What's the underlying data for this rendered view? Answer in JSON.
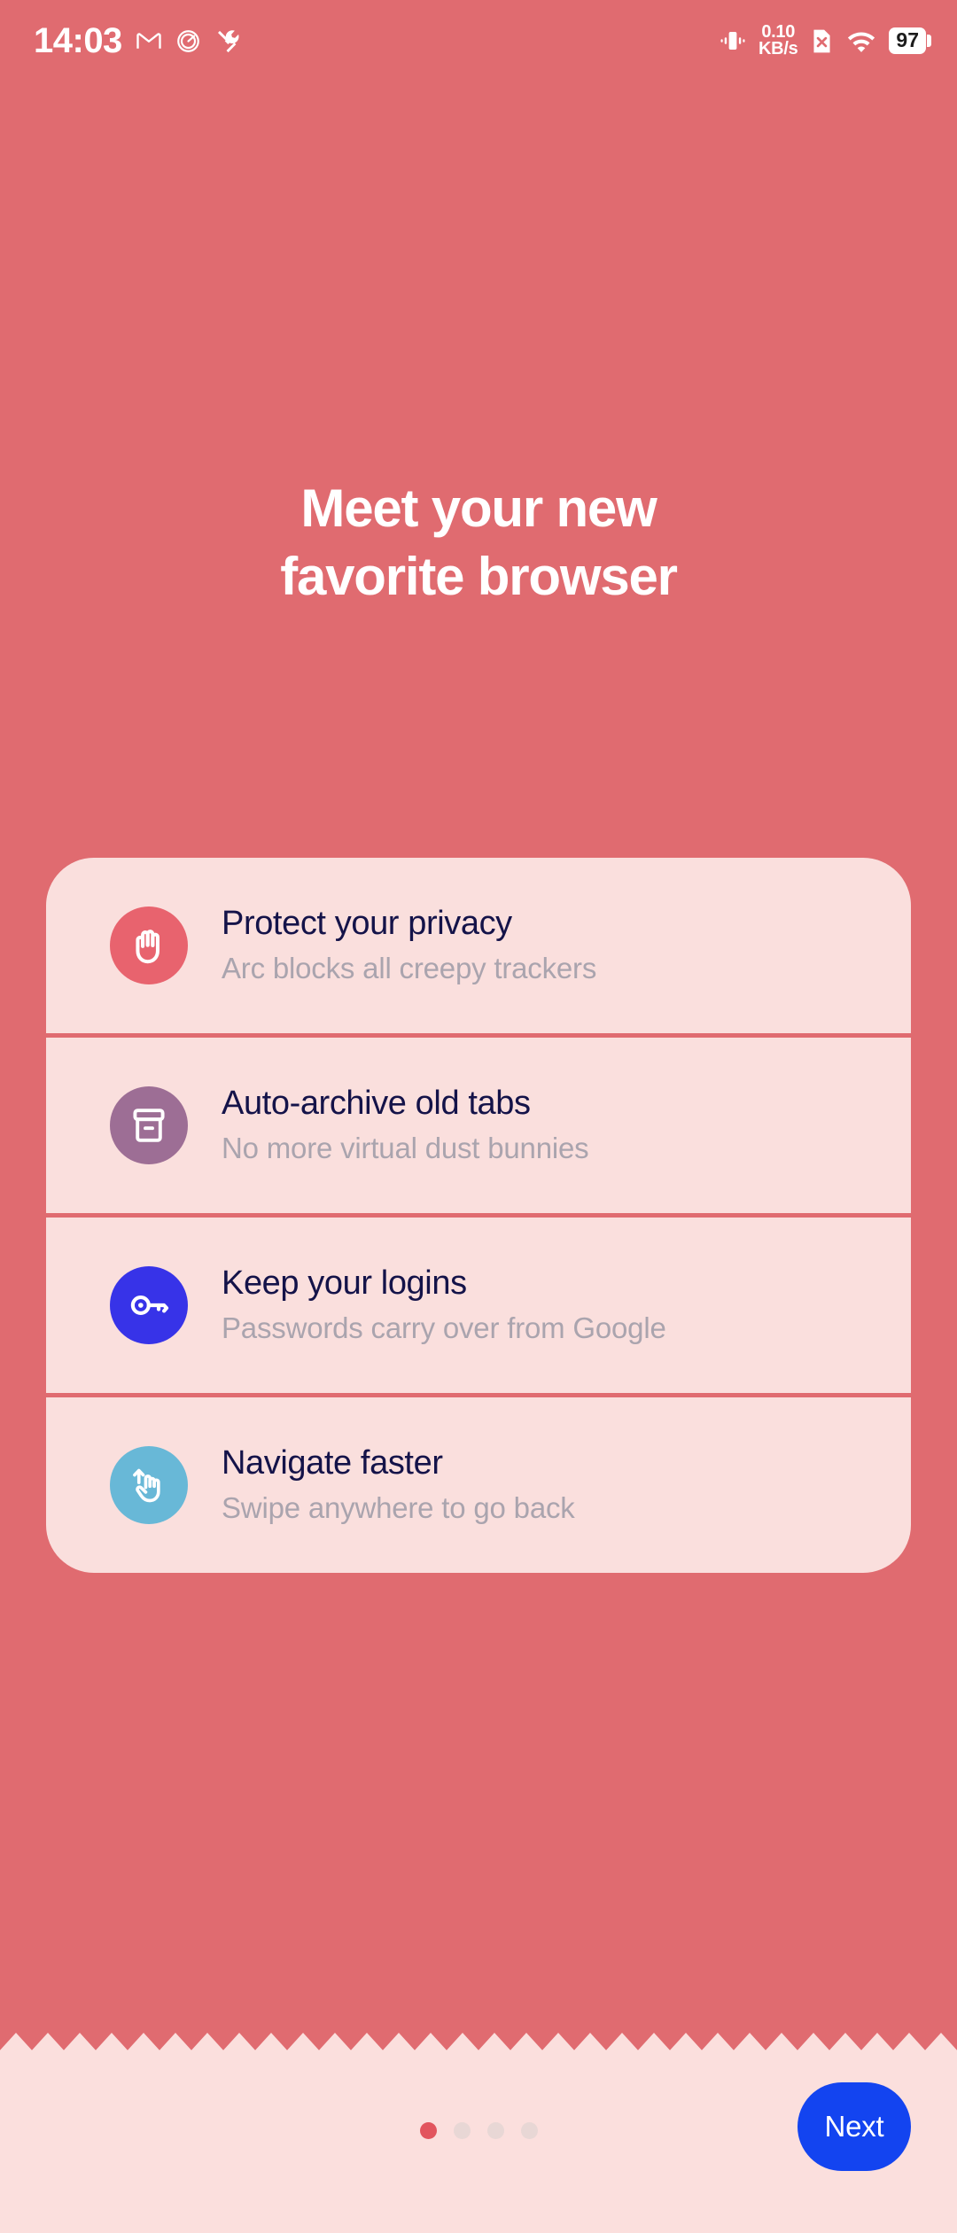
{
  "status_bar": {
    "clock": "14:03",
    "left_icons": [
      "gmail-icon",
      "clock-circle-icon",
      "tools-icon"
    ],
    "network_speed_value": "0.10",
    "network_speed_unit": "KB/s",
    "right_icons": [
      "vibrate-icon",
      "sim-off-icon",
      "wifi-icon"
    ],
    "battery_level": "97"
  },
  "headline": {
    "line1": "Meet your new",
    "line2": "favorite browser",
    "full": "Meet your new favorite browser"
  },
  "features": [
    {
      "icon": "raised-hand-icon",
      "icon_bg": "#e8636e",
      "title": "Protect your privacy",
      "subtitle": "Arc blocks all creepy trackers"
    },
    {
      "icon": "archive-box-icon",
      "icon_bg": "#9d6e95",
      "title": "Auto-archive old tabs",
      "subtitle": "No more virtual dust bunnies"
    },
    {
      "icon": "key-icon",
      "icon_bg": "#3733e8",
      "title": "Keep your logins",
      "subtitle": "Passwords carry over from Google"
    },
    {
      "icon": "swipe-gesture-icon",
      "icon_bg": "#68b8d7",
      "title": "Navigate faster",
      "subtitle": "Swipe anywhere to go back"
    }
  ],
  "bottom_bar": {
    "page_count": 4,
    "active_page_index": 0,
    "next_label": "Next"
  },
  "colors": {
    "background": "#e06b70",
    "card": "#fadfdd",
    "sheet": "#fbdfdd",
    "title_text": "#141349",
    "subtitle_text": "#aaa4ae",
    "accent_blue": "#1344f0",
    "active_dot": "#e2555e",
    "inactive_dot": "#e8d7d5"
  }
}
